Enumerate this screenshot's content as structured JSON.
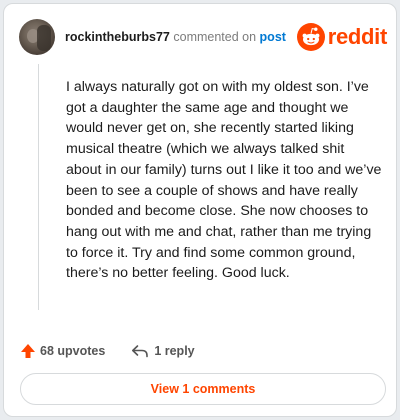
{
  "header": {
    "username": "rockintheburbs77",
    "action_text": "commented on",
    "post_link": "post",
    "logo_text": "reddit"
  },
  "comment": {
    "body": "I always naturally got on with my oldest son. I’ve got a daughter the same age and thought we would never get on, she recently started liking musical theatre (which we always talked shit about in our family) turns out I like it too and we’ve been to see a couple of shows and have really bonded and become close. She now chooses to hang out with me and chat, rather than me trying to force it. Try and find some common ground, there’s no better feeling. Good luck."
  },
  "actions": {
    "upvotes": "68 upvotes",
    "replies": "1 reply"
  },
  "footer": {
    "view_comments": "View 1 comments"
  },
  "colors": {
    "brand": "#ff4500",
    "link": "#0079d3",
    "border": "#d7dadc"
  },
  "icons": {
    "logo": "reddit-snoo-icon",
    "upvote": "upvote-arrow-icon",
    "reply": "reply-arrow-icon"
  }
}
